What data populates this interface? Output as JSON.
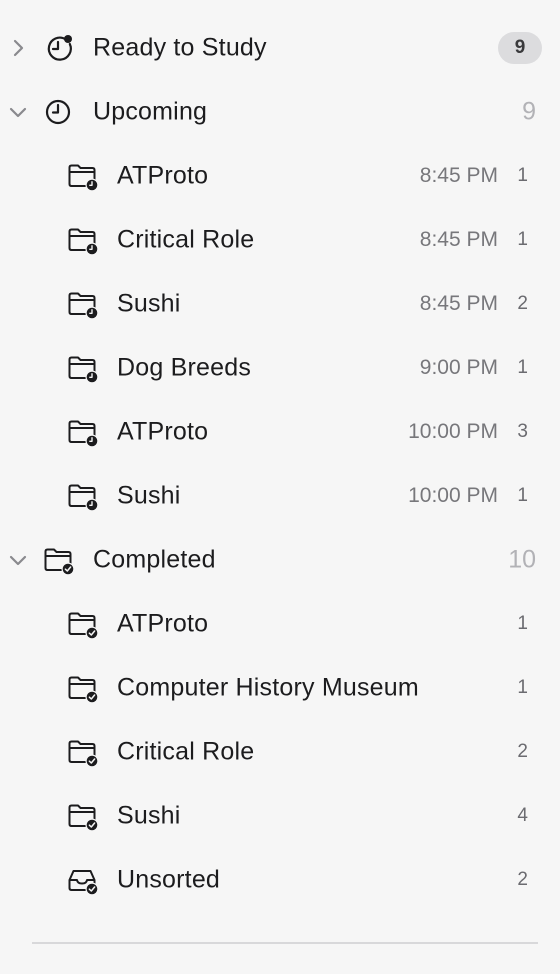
{
  "sections": {
    "ready": {
      "label": "Ready to Study",
      "count": "9",
      "icon": "clock-alert-icon",
      "chevron": "chevron-right-icon"
    },
    "upcoming": {
      "label": "Upcoming",
      "count": "9",
      "icon": "clock-icon",
      "chevron": "chevron-down-icon",
      "items": [
        {
          "label": "ATProto",
          "time": "8:45 PM",
          "count": "1"
        },
        {
          "label": "Critical Role",
          "time": "8:45 PM",
          "count": "1"
        },
        {
          "label": "Sushi",
          "time": "8:45 PM",
          "count": "2"
        },
        {
          "label": "Dog Breeds",
          "time": "9:00 PM",
          "count": "1"
        },
        {
          "label": "ATProto",
          "time": "10:00 PM",
          "count": "3"
        },
        {
          "label": "Sushi",
          "time": "10:00 PM",
          "count": "1"
        }
      ]
    },
    "completed": {
      "label": "Completed",
      "count": "10",
      "icon": "folder-check-icon",
      "chevron": "chevron-down-icon",
      "items": [
        {
          "label": "ATProto",
          "count": "1",
          "icon": "folder-check-icon"
        },
        {
          "label": "Computer History Museum",
          "count": "1",
          "icon": "folder-check-icon"
        },
        {
          "label": "Critical Role",
          "count": "2",
          "icon": "folder-check-icon"
        },
        {
          "label": "Sushi",
          "count": "4",
          "icon": "folder-check-icon"
        },
        {
          "label": "Unsorted",
          "count": "2",
          "icon": "tray-check-icon"
        }
      ]
    }
  },
  "colors": {
    "background": "#f6f6f6",
    "text": "#1c1c1e",
    "muted": "#77777b",
    "badge": "#dcdcde"
  }
}
